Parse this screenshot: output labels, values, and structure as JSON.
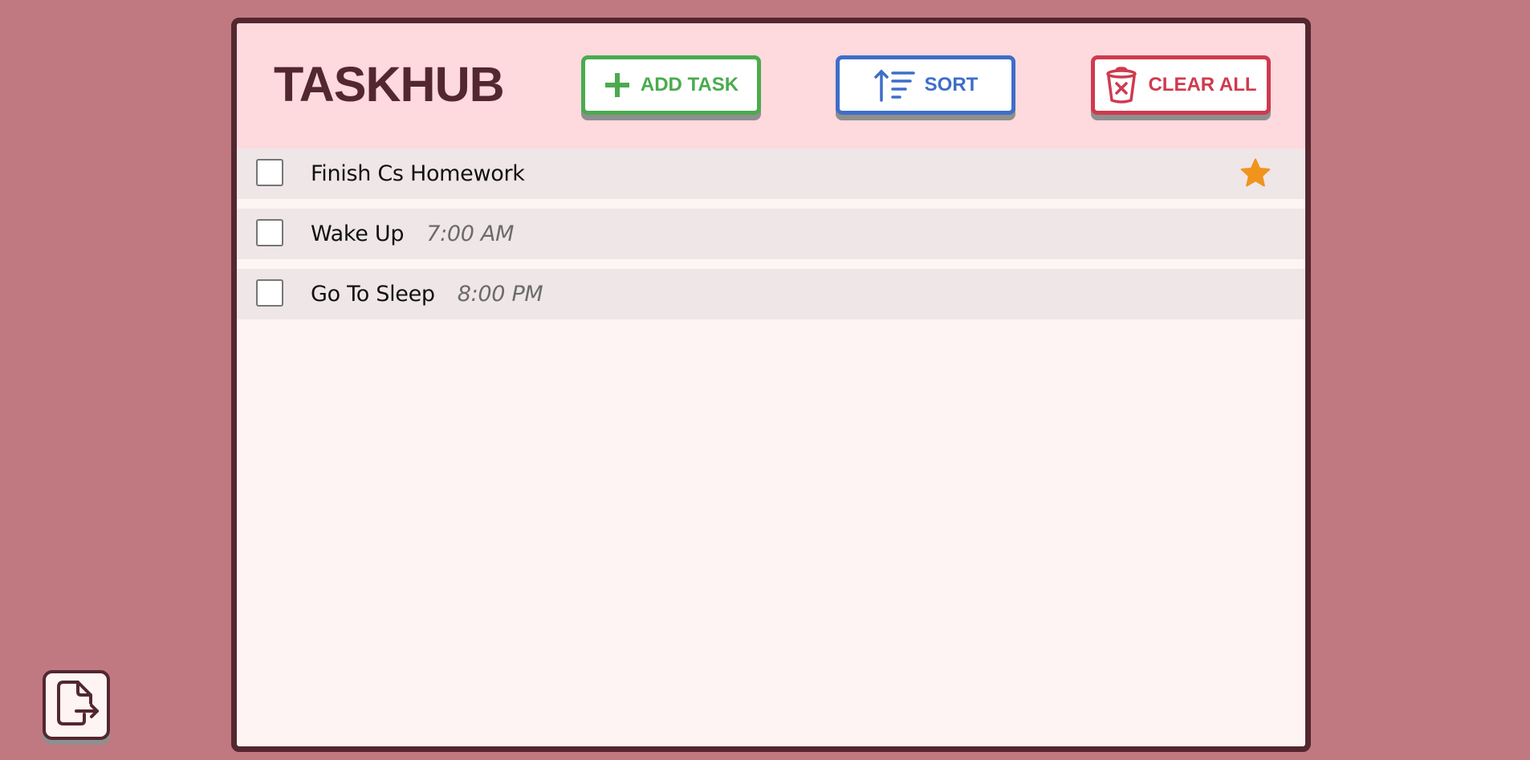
{
  "app": {
    "title": "TASKHUB"
  },
  "toolbar": {
    "add_label": "ADD TASK",
    "sort_label": "SORT",
    "clear_label": "CLEAR ALL"
  },
  "tasks": [
    {
      "label": "Finish Cs Homework",
      "time": "",
      "starred": true,
      "checked": false
    },
    {
      "label": "Wake Up",
      "time": "7:00 AM",
      "starred": false,
      "checked": false
    },
    {
      "label": "Go To Sleep",
      "time": "8:00 PM",
      "starred": false,
      "checked": false
    }
  ],
  "icons": {
    "add": "plus-icon",
    "sort": "sort-ascending-icon",
    "clear": "trash-x-icon",
    "star": "star-icon",
    "export": "file-export-icon"
  },
  "colors": {
    "background": "#c17981",
    "window_border": "#532730",
    "header_bg": "#fed9dd",
    "add": "#4aab4d",
    "sort": "#3e6ec8",
    "clear": "#cf3a4e",
    "star": "#f0941e",
    "row_bg": "#efe6e7"
  }
}
